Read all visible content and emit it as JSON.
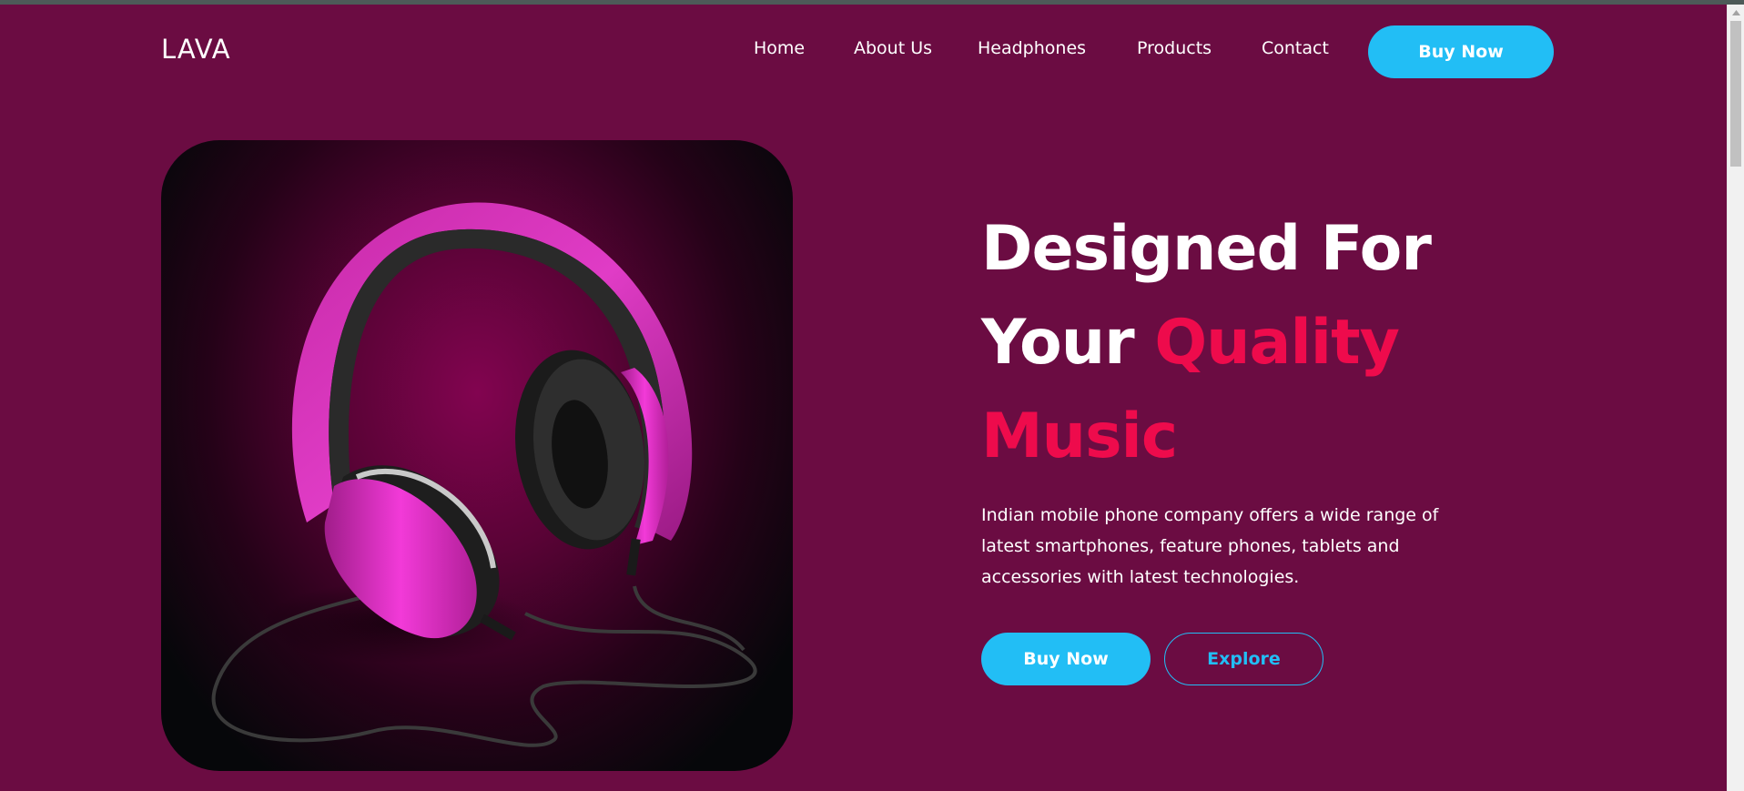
{
  "brand": {
    "logo": "LAVA"
  },
  "nav": {
    "items": [
      "Home",
      "About Us",
      "Headphones",
      "Products",
      "Contact"
    ],
    "cta": "Buy Now"
  },
  "hero": {
    "headline_line1": "Designed For",
    "headline_line2_plain": "Your ",
    "headline_line2_accent": "Quality",
    "headline_line3_accent": "Music",
    "description": "Indian mobile phone company offers a wide range of latest smartphones, feature phones, tablets and accessories with latest technologies.",
    "primary_button": "Buy Now",
    "secondary_button": "Explore",
    "image_icon": "headphones-icon"
  },
  "colors": {
    "background": "#6b0c42",
    "accent": "#ee0b4c",
    "button": "#22bef5"
  }
}
